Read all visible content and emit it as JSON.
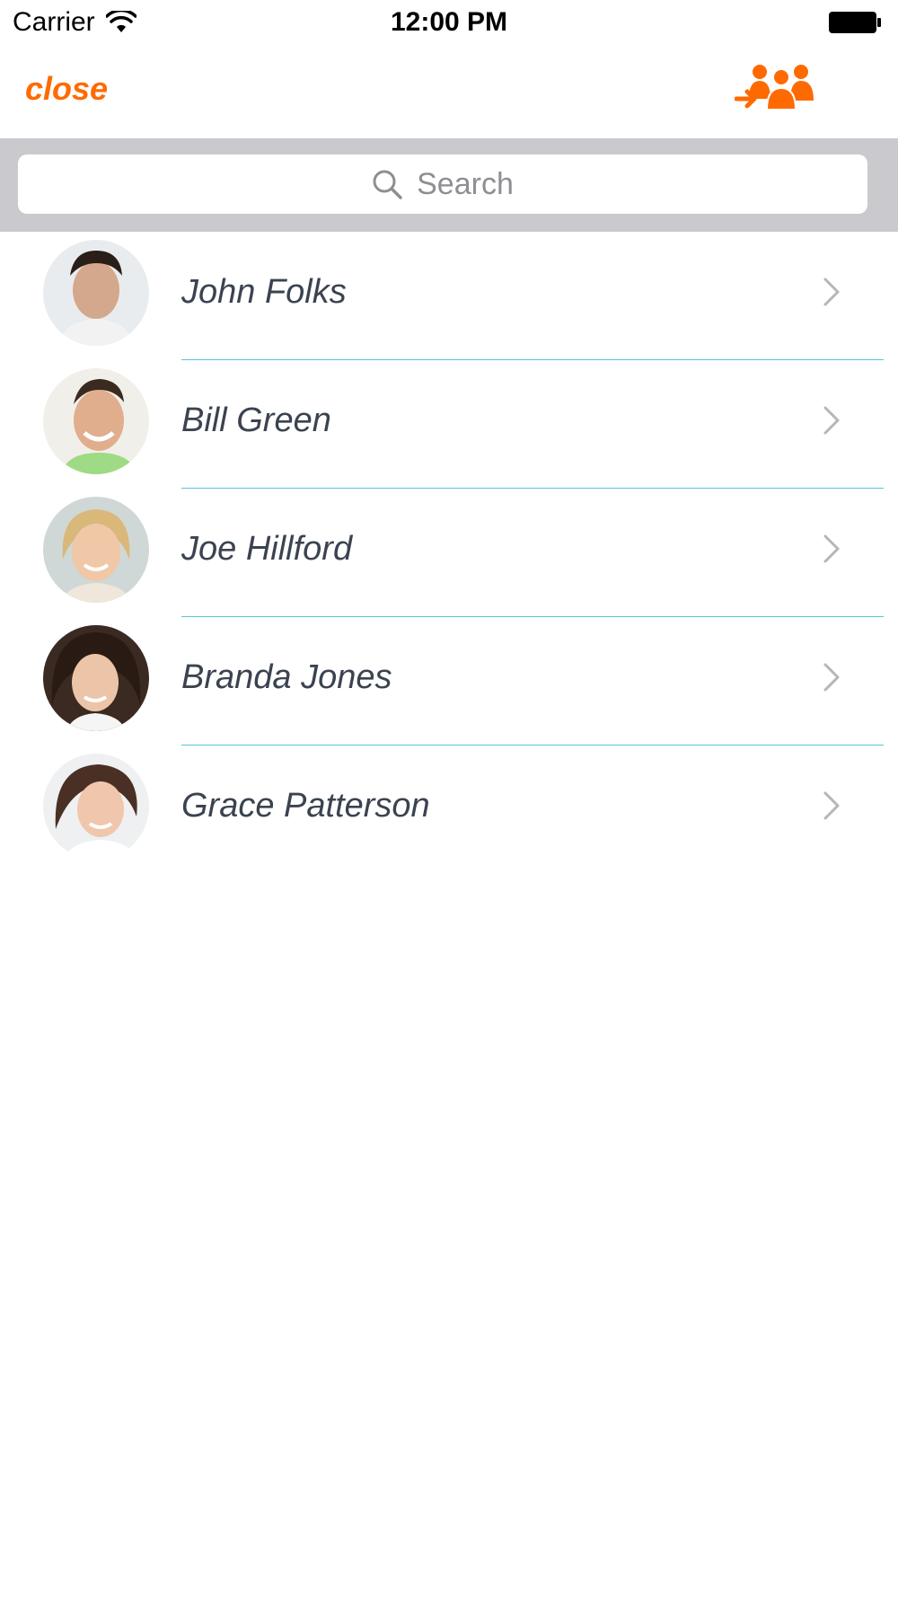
{
  "status_bar": {
    "carrier": "Carrier",
    "time": "12:00 PM",
    "wifi_icon": "wifi-icon",
    "battery_icon": "battery-icon"
  },
  "nav": {
    "close_label": "close",
    "group_icon": "group-add-icon",
    "accent_color": "#ff6a00"
  },
  "search": {
    "placeholder": "Search",
    "icon": "search-icon"
  },
  "contacts": [
    {
      "name": "John Folks",
      "avatar_color": "#7a5a48"
    },
    {
      "name": "Bill Green",
      "avatar_color": "#c89a7a"
    },
    {
      "name": "Joe Hillford",
      "avatar_color": "#d8b486"
    },
    {
      "name": "Branda Jones",
      "avatar_color": "#4a3026"
    },
    {
      "name": "Grace Patterson",
      "avatar_color": "#8a6a58"
    }
  ],
  "colors": {
    "separator": "#58c4d8",
    "name_text": "#3b4350",
    "search_bar_bg": "#c9c9ce"
  }
}
